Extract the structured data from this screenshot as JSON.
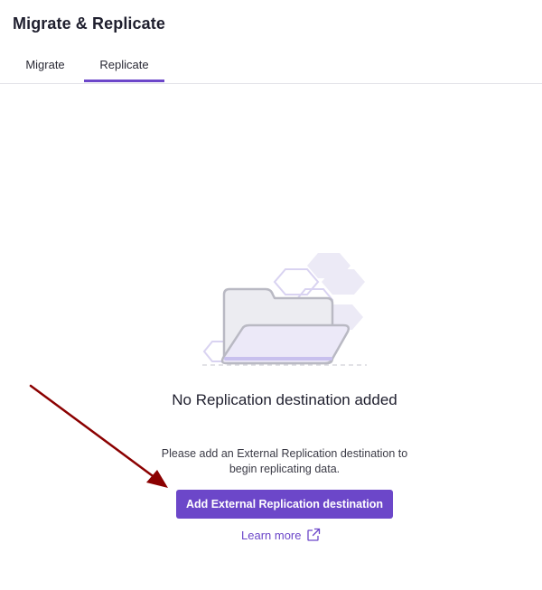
{
  "header": {
    "title": "Migrate & Replicate"
  },
  "tabs": [
    {
      "label": "Migrate",
      "active": false
    },
    {
      "label": "Replicate",
      "active": true
    }
  ],
  "empty_state": {
    "illustration_icon": "folder-icon",
    "title": "No Replication destination added",
    "description": "Please add an External Replication destination to begin replicating data.",
    "primary_button_label": "Add External Replication destination",
    "learn_more_label": "Learn more",
    "learn_more_icon": "external-link-icon"
  },
  "annotation": {
    "arrow_color": "#8b0000",
    "points_to": "Add External Replication destination"
  },
  "colors": {
    "accent": "#6c47c9",
    "tab_border": "#e3e3e8"
  }
}
